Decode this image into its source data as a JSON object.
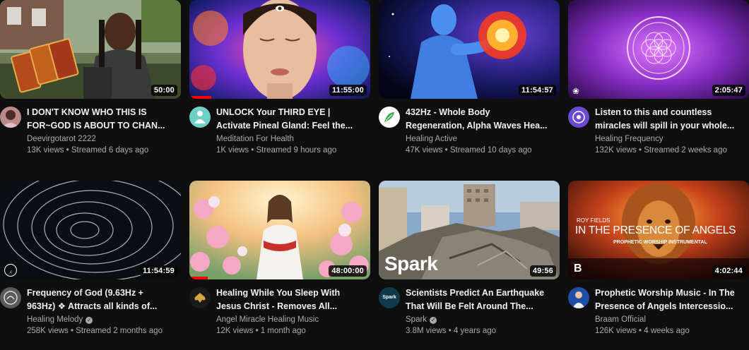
{
  "videos": [
    {
      "title": "I DON'T KNOW WHO THIS IS\nFOR~GOD IS ABOUT TO CHAN...",
      "channel": "Deevirgotarot 2222",
      "views": "13K views",
      "age": "Streamed 6 days ago",
      "duration": "50:00",
      "verified": false
    },
    {
      "title": "UNLOCK Your THIRD EYE |\nActivate Pineal Gland: Feel the...",
      "channel": "Meditation For Health",
      "views": "1K views",
      "age": "Streamed 9 hours ago",
      "duration": "11:55:00",
      "verified": false,
      "watched_fraction": 0.12
    },
    {
      "title": "432Hz - Whole Body\nRegeneration, Alpha Waves Hea...",
      "channel": "Healing Active",
      "views": "47K views",
      "age": "Streamed 10 days ago",
      "duration": "11:54:57",
      "verified": false
    },
    {
      "title": "Listen to this and countless\nmiracles will spill in your whole...",
      "channel": "Healing Frequency",
      "views": "132K views",
      "age": "Streamed 2 weeks ago",
      "duration": "2:05:47",
      "verified": false
    },
    {
      "title": "Frequency of God (9.63Hz +\n963Hz) ❖ Attracts all kinds of...",
      "channel": "Healing Melody",
      "views": "258K views",
      "age": "Streamed 2 months ago",
      "duration": "11:54:59",
      "verified": true
    },
    {
      "title": "Healing While You Sleep With\nJesus Christ - Removes All...",
      "channel": "Angel Miracle Healing Music",
      "views": "12K views",
      "age": "1 month ago",
      "duration": "48:00:00",
      "verified": false,
      "watched_fraction": 0.1
    },
    {
      "title": "Scientists Predict An Earthquake\nThat Will Be Felt Around The...",
      "channel": "Spark",
      "views": "3.8M views",
      "age": "4 years ago",
      "duration": "49:56",
      "verified": true,
      "thumb_text": "Spark",
      "avatar_text": "Spark"
    },
    {
      "title": "Prophetic Worship Music - In The\nPresence of Angels Intercessio...",
      "channel": "Braam Official",
      "views": "126K views",
      "age": "4 weeks ago",
      "duration": "4:02:44",
      "verified": false,
      "thumb_text": {
        "artist": "ROY FIELDS",
        "headline": "IN THE PRESENCE OF ANGELS",
        "sub": "PROPHETIC WORSHIP INSTRUMENTAL",
        "logo": "B"
      }
    }
  ],
  "separator": " • ",
  "verified_icon": "check-circle-icon",
  "colors": {
    "background": "#0f0f0f",
    "title": "#f1f1f1",
    "secondary": "#aaaaaa",
    "progress": "#ff0000"
  }
}
